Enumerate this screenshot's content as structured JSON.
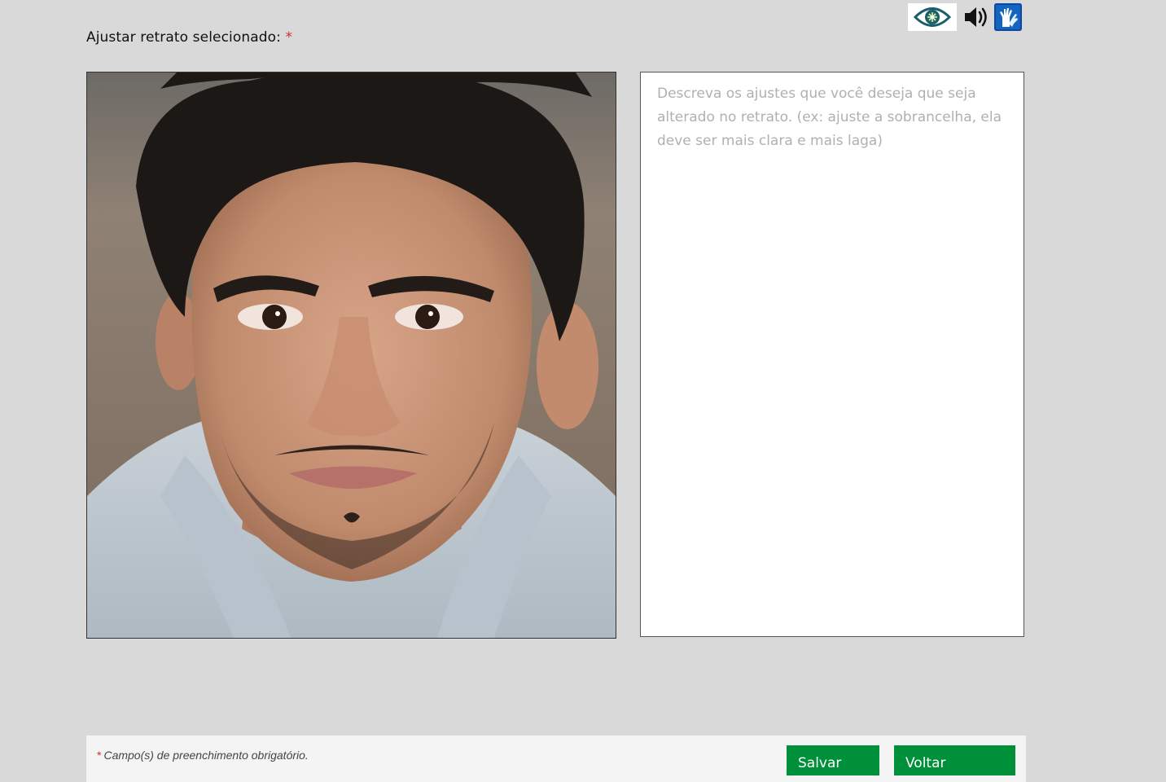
{
  "accessibility": {
    "icons": [
      "eye-icon",
      "speaker-icon",
      "sign-language-icon"
    ]
  },
  "form": {
    "label": "Ajustar retrato selecionado:",
    "required_mark": "*",
    "textarea_placeholder": "Descreva os ajustes que você deseja que seja alterado no retrato. (ex: ajuste a sobrancelha, ela deve ser mais clara e mais laga)",
    "textarea_value": ""
  },
  "footer": {
    "required_mark": "*",
    "required_note": "Campo(s) de preenchimento obrigatório.",
    "save_label": "Salvar",
    "back_label": "Voltar"
  },
  "colors": {
    "page_bg": "#d9d9d9",
    "button_green": "#009039",
    "required_red": "#d32f2f",
    "a11y_blue": "#1565c0"
  }
}
